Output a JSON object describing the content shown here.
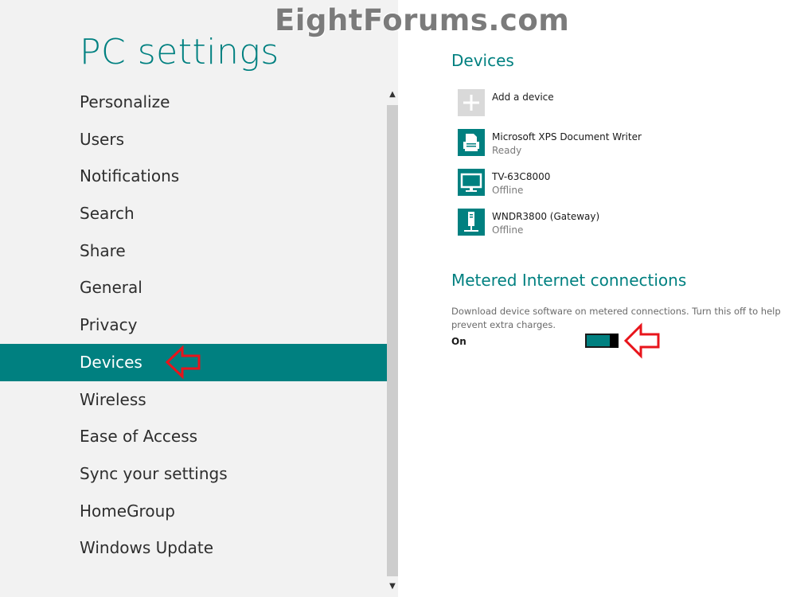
{
  "watermark": "EightForums.com",
  "app_title": "PC settings",
  "nav": {
    "items": [
      {
        "label": "Personalize"
      },
      {
        "label": "Users"
      },
      {
        "label": "Notifications"
      },
      {
        "label": "Search"
      },
      {
        "label": "Share"
      },
      {
        "label": "General"
      },
      {
        "label": "Privacy"
      },
      {
        "label": "Devices"
      },
      {
        "label": "Wireless"
      },
      {
        "label": "Ease of Access"
      },
      {
        "label": "Sync your settings"
      },
      {
        "label": "HomeGroup"
      },
      {
        "label": "Windows Update"
      }
    ],
    "selected": "Devices"
  },
  "devices": {
    "title": "Devices",
    "add_label": "Add a device",
    "list": [
      {
        "name": "Microsoft XPS Document Writer",
        "status": "Ready",
        "icon": "printer-icon"
      },
      {
        "name": "TV-63C8000",
        "status": "Offline",
        "icon": "monitor-icon"
      },
      {
        "name": "WNDR3800 (Gateway)",
        "status": "Offline",
        "icon": "router-icon"
      }
    ]
  },
  "metered": {
    "title": "Metered Internet connections",
    "description": "Download device software on metered connections. Turn this off to help prevent extra charges.",
    "toggle_label": "On",
    "toggle_on": true
  },
  "colors": {
    "accent": "#008080",
    "annotation_arrow": "#e8141b"
  }
}
